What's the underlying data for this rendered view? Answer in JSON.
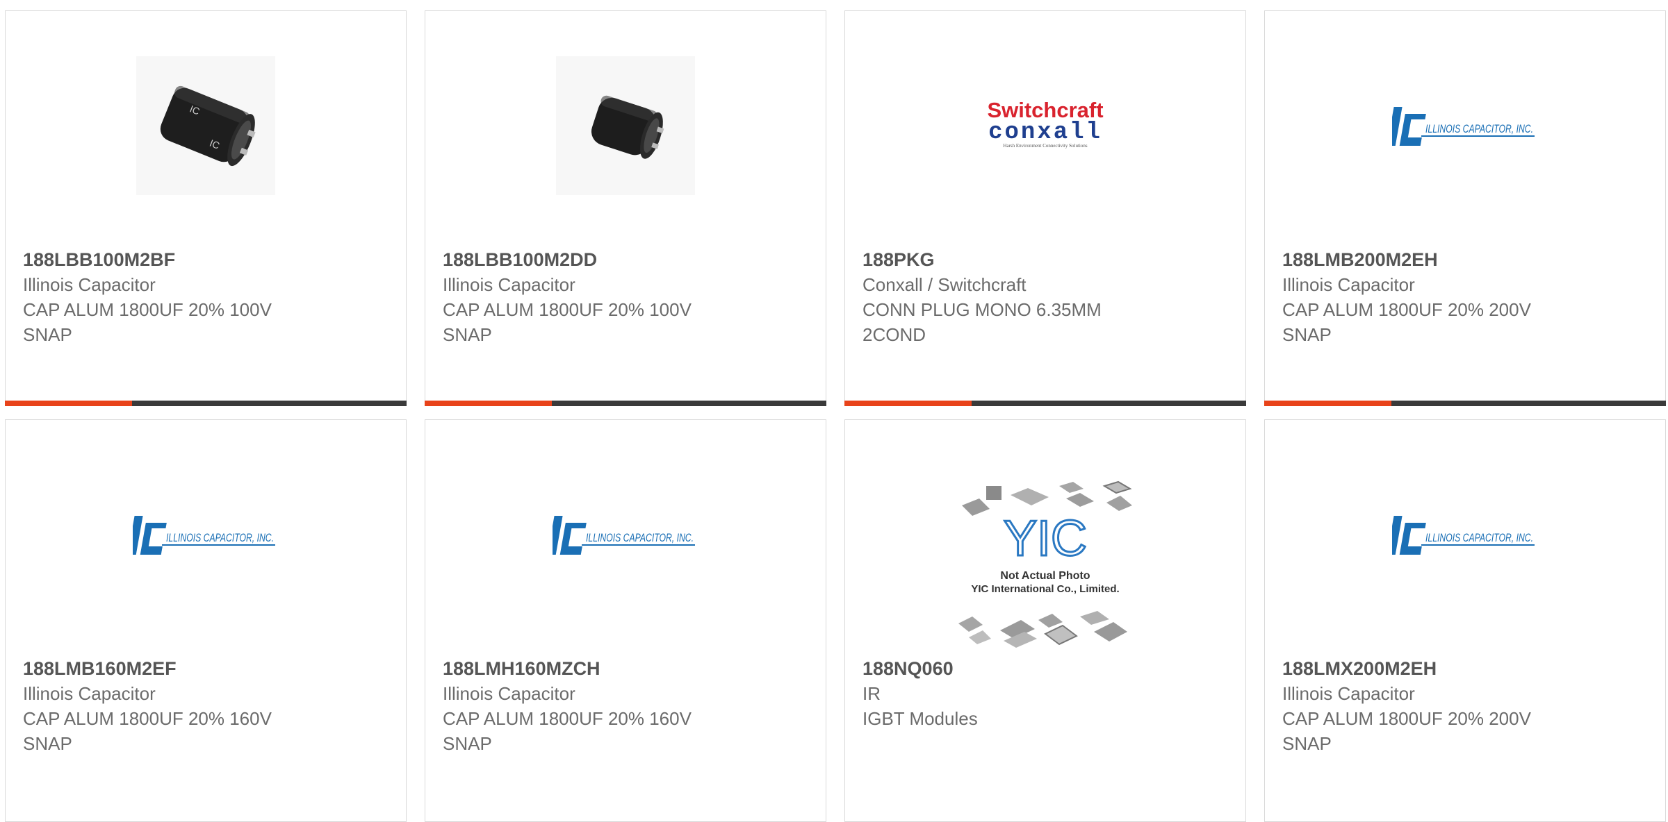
{
  "colors": {
    "accent": "#e8431a",
    "bar": "#3a3a3a",
    "ic_blue": "#1a6fb5",
    "switchcraft_red": "#d9232e",
    "conxall_blue": "#1f3f8f"
  },
  "cards": [
    {
      "part_number": "188LBB100M2BF",
      "manufacturer": "Illinois Capacitor",
      "description": "CAP ALUM 1800UF 20% 100V SNAP",
      "image": "capacitor-photo-large"
    },
    {
      "part_number": "188LBB100M2DD",
      "manufacturer": "Illinois Capacitor",
      "description": "CAP ALUM 1800UF 20% 100V SNAP",
      "image": "capacitor-photo-small"
    },
    {
      "part_number": "188PKG",
      "manufacturer": "Conxall / Switchcraft",
      "description": "CONN PLUG MONO 6.35MM 2COND",
      "image": "switchcraft-conxall-logo",
      "logo": {
        "line1": "Switchcraft",
        "line2": "conxall",
        "tagline": "Harsh Environment Connectivity Solutions"
      }
    },
    {
      "part_number": "188LMB200M2EH",
      "manufacturer": "Illinois Capacitor",
      "description": "CAP ALUM 1800UF 20% 200V SNAP",
      "image": "illinois-capacitor-logo",
      "logo": {
        "text": "ILLINOIS CAPACITOR, INC."
      }
    },
    {
      "part_number": "188LMB160M2EF",
      "manufacturer": "Illinois Capacitor",
      "description": "CAP ALUM 1800UF 20% 160V SNAP",
      "image": "illinois-capacitor-logo",
      "logo": {
        "text": "ILLINOIS CAPACITOR, INC."
      }
    },
    {
      "part_number": "188LMH160MZCH",
      "manufacturer": "Illinois Capacitor",
      "description": "CAP ALUM 1800UF 20% 160V SNAP",
      "image": "illinois-capacitor-logo",
      "logo": {
        "text": "ILLINOIS CAPACITOR, INC."
      }
    },
    {
      "part_number": "188NQ060",
      "manufacturer": "IR",
      "description": "IGBT Modules",
      "image": "yic-placeholder",
      "logo": {
        "text": "YIC",
        "caption1": "Not Actual Photo",
        "caption2": "YIC International Co., Limited."
      }
    },
    {
      "part_number": "188LMX200M2EH",
      "manufacturer": "Illinois Capacitor",
      "description": "CAP ALUM 1800UF 20% 200V SNAP",
      "image": "illinois-capacitor-logo",
      "logo": {
        "text": "ILLINOIS CAPACITOR, INC."
      }
    }
  ]
}
